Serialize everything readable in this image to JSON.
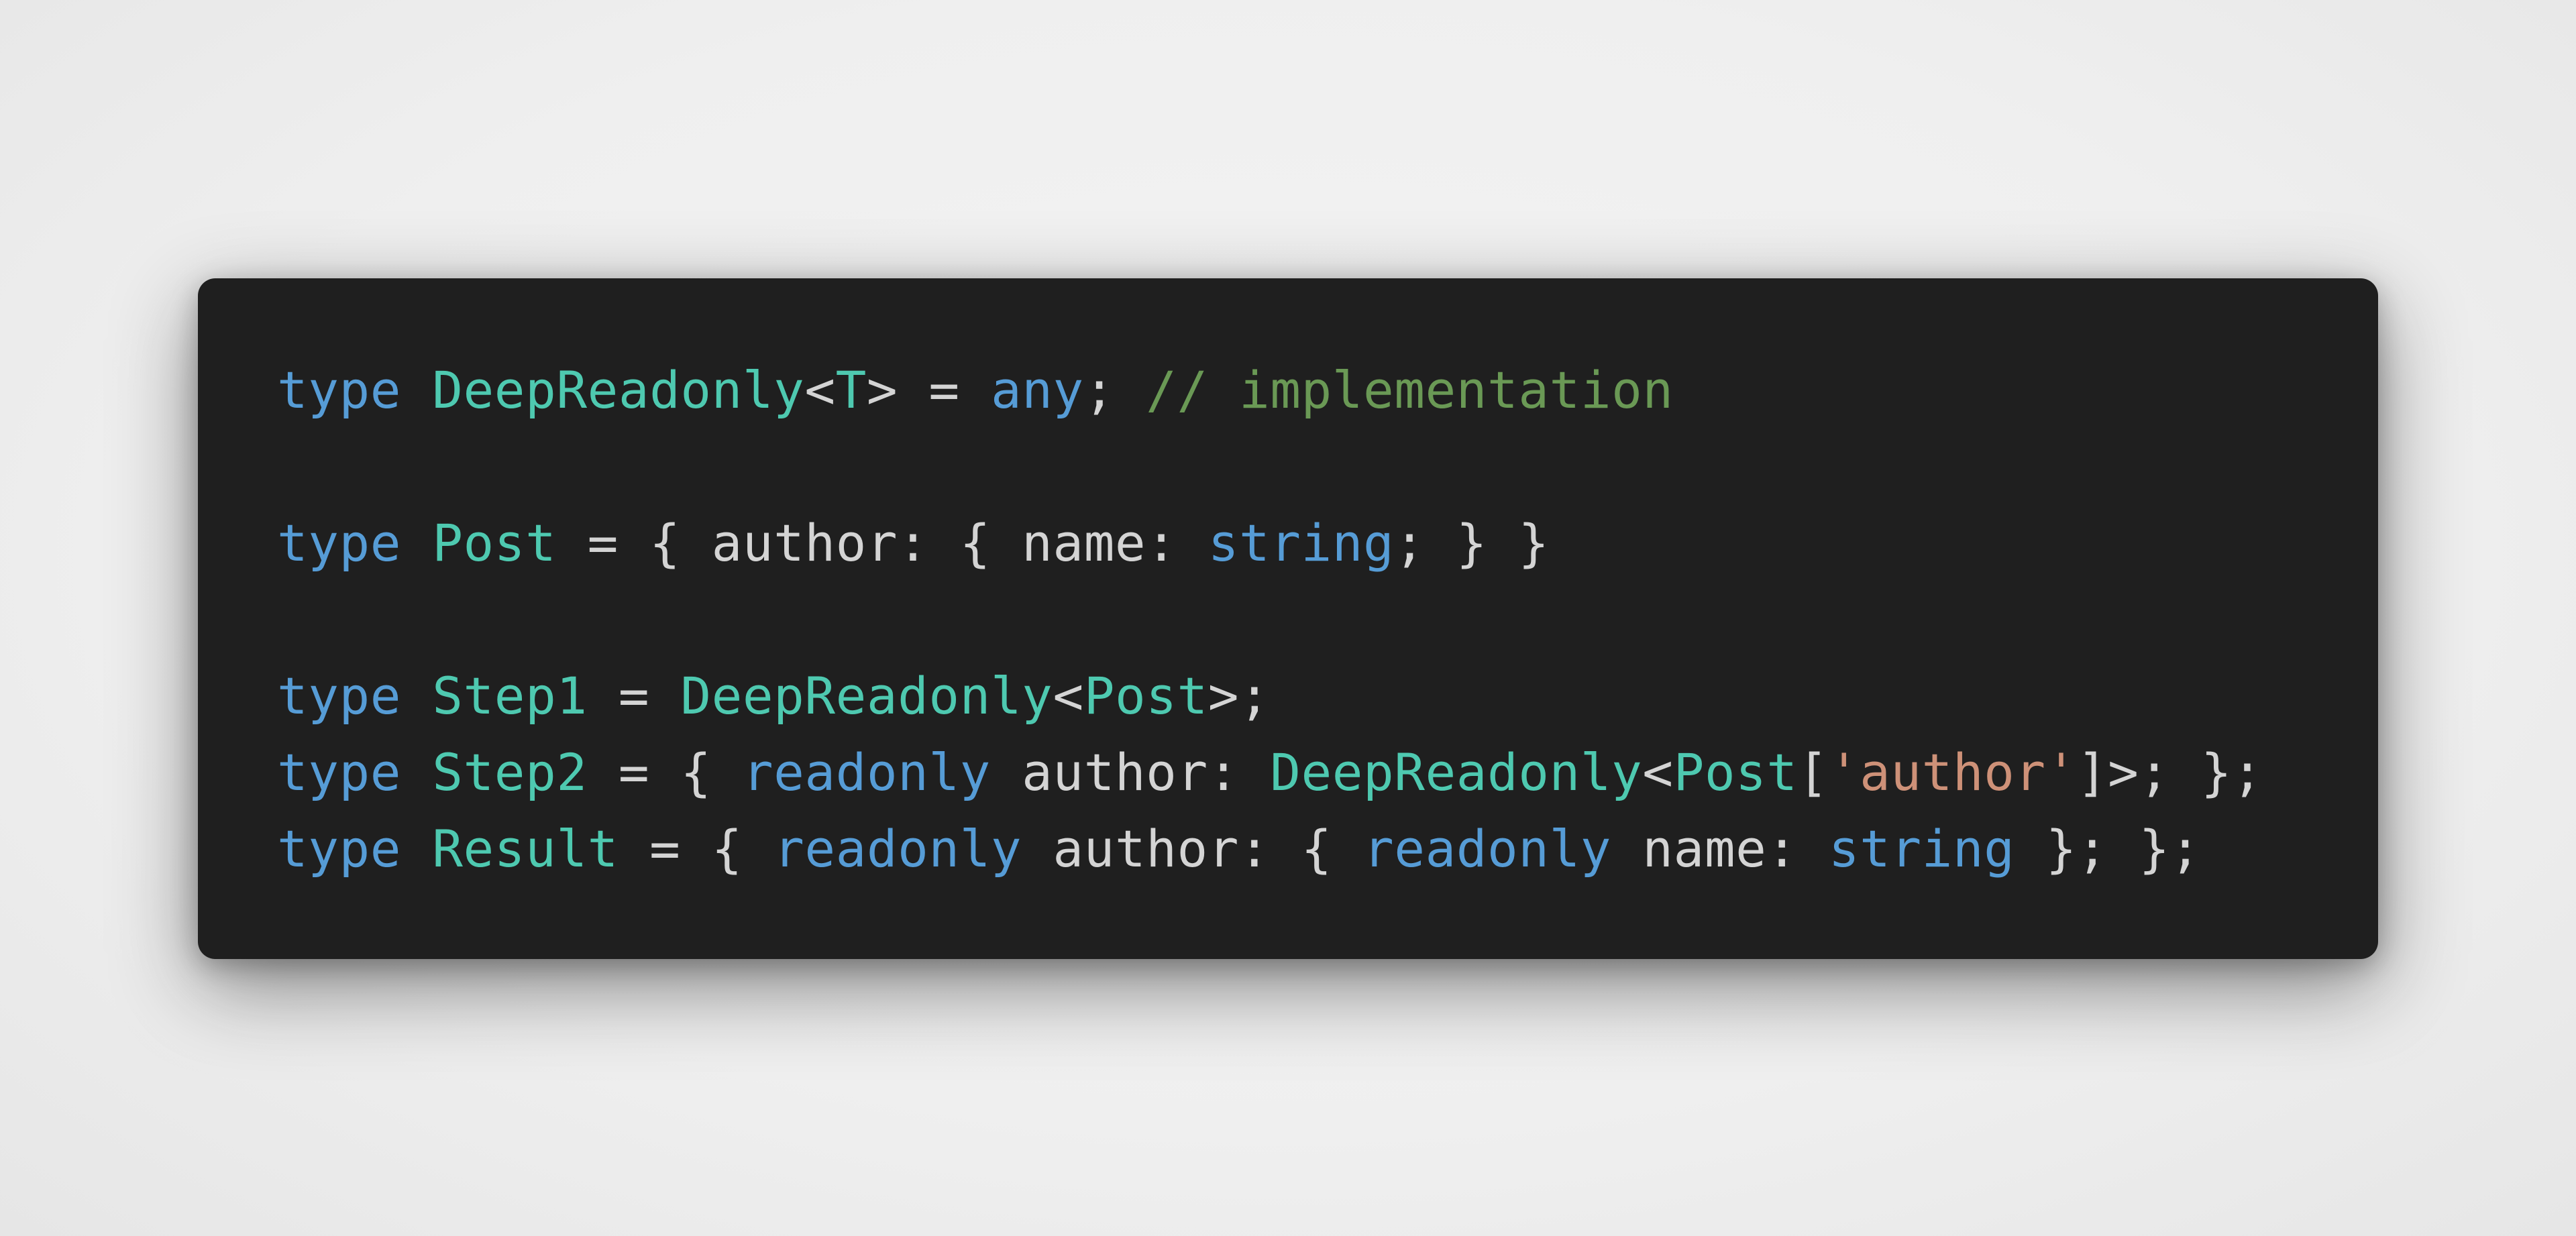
{
  "code_block": {
    "language": "typescript",
    "colors": {
      "background": "#1f1f1f",
      "keyword": "#569cd6",
      "type": "#4ec9b0",
      "string": "#ce9178",
      "comment": "#6a9955",
      "plain": "#d4d4d4"
    },
    "lines": [
      {
        "tokens": [
          {
            "t": "type",
            "c": "kw"
          },
          {
            "t": " ",
            "c": "pl"
          },
          {
            "t": "DeepReadonly",
            "c": "ty"
          },
          {
            "t": "<",
            "c": "pl"
          },
          {
            "t": "T",
            "c": "ty"
          },
          {
            "t": "> = ",
            "c": "pl"
          },
          {
            "t": "any",
            "c": "kw"
          },
          {
            "t": "; ",
            "c": "pl"
          },
          {
            "t": "// implementation",
            "c": "com"
          }
        ]
      },
      {
        "tokens": []
      },
      {
        "tokens": [
          {
            "t": "type",
            "c": "kw"
          },
          {
            "t": " ",
            "c": "pl"
          },
          {
            "t": "Post",
            "c": "ty"
          },
          {
            "t": " = { author: { name: ",
            "c": "pl"
          },
          {
            "t": "string",
            "c": "kw"
          },
          {
            "t": "; } }",
            "c": "pl"
          }
        ]
      },
      {
        "tokens": []
      },
      {
        "tokens": [
          {
            "t": "type",
            "c": "kw"
          },
          {
            "t": " ",
            "c": "pl"
          },
          {
            "t": "Step1",
            "c": "ty"
          },
          {
            "t": " = ",
            "c": "pl"
          },
          {
            "t": "DeepReadonly",
            "c": "ty"
          },
          {
            "t": "<",
            "c": "pl"
          },
          {
            "t": "Post",
            "c": "ty"
          },
          {
            "t": ">;",
            "c": "pl"
          }
        ]
      },
      {
        "tokens": [
          {
            "t": "type",
            "c": "kw"
          },
          {
            "t": " ",
            "c": "pl"
          },
          {
            "t": "Step2",
            "c": "ty"
          },
          {
            "t": " = { ",
            "c": "pl"
          },
          {
            "t": "readonly",
            "c": "kw"
          },
          {
            "t": " author: ",
            "c": "pl"
          },
          {
            "t": "DeepReadonly",
            "c": "ty"
          },
          {
            "t": "<",
            "c": "pl"
          },
          {
            "t": "Post",
            "c": "ty"
          },
          {
            "t": "[",
            "c": "pl"
          },
          {
            "t": "'author'",
            "c": "str"
          },
          {
            "t": "]>; };",
            "c": "pl"
          }
        ]
      },
      {
        "tokens": [
          {
            "t": "type",
            "c": "kw"
          },
          {
            "t": " ",
            "c": "pl"
          },
          {
            "t": "Result",
            "c": "ty"
          },
          {
            "t": " = { ",
            "c": "pl"
          },
          {
            "t": "readonly",
            "c": "kw"
          },
          {
            "t": " author: { ",
            "c": "pl"
          },
          {
            "t": "readonly",
            "c": "kw"
          },
          {
            "t": " name: ",
            "c": "pl"
          },
          {
            "t": "string",
            "c": "kw"
          },
          {
            "t": " }; };",
            "c": "pl"
          }
        ]
      }
    ]
  }
}
